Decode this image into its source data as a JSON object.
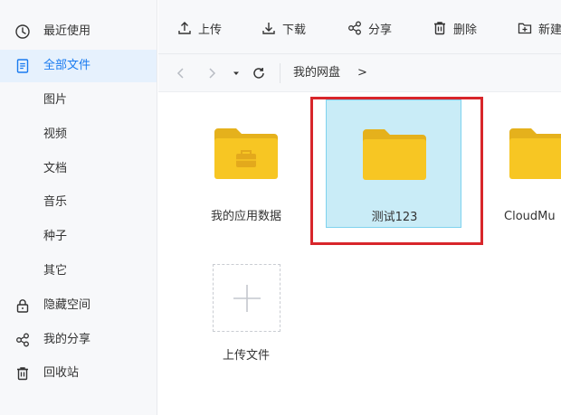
{
  "sidebar": {
    "items": [
      {
        "label": "最近使用",
        "icon": "clock-icon"
      },
      {
        "label": "全部文件",
        "icon": "document-icon"
      },
      {
        "label": "图片"
      },
      {
        "label": "视频"
      },
      {
        "label": "文档"
      },
      {
        "label": "音乐"
      },
      {
        "label": "种子"
      },
      {
        "label": "其它"
      },
      {
        "label": "隐藏空间",
        "icon": "lock-icon"
      },
      {
        "label": "我的分享",
        "icon": "share-icon"
      },
      {
        "label": "回收站",
        "icon": "trash-icon"
      }
    ]
  },
  "toolbar": {
    "upload": "上传",
    "download": "下载",
    "share": "分享",
    "delete": "删除",
    "new_folder": "新建"
  },
  "nav": {
    "breadcrumb": "我的网盘",
    "separator": ">"
  },
  "files": [
    {
      "name": "我的应用数据"
    },
    {
      "name": "测试123"
    },
    {
      "name": "CloudMu"
    }
  ],
  "upload_tile": {
    "label": "上传文件"
  },
  "colors": {
    "accent": "#1a7bf0",
    "folder": "#f7c623",
    "folder_dark": "#e5b11c",
    "selection": "#c9ecf7",
    "highlight": "#d8262b"
  }
}
